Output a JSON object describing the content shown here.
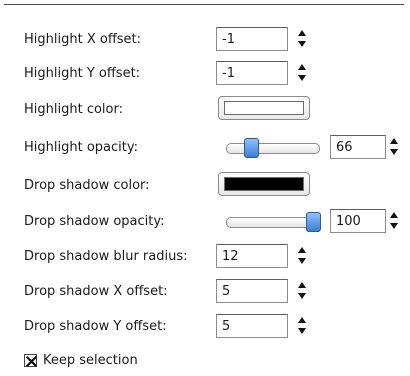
{
  "fields": {
    "highlight_x_offset": {
      "label": "Highlight X offset:",
      "value": "-1"
    },
    "highlight_y_offset": {
      "label": "Highlight Y offset:",
      "value": "-1"
    },
    "highlight_color": {
      "label": "Highlight color:",
      "color": "#ffffff"
    },
    "highlight_opacity": {
      "label": "Highlight opacity:",
      "value": "66",
      "level_percent": 22
    },
    "drop_shadow_color": {
      "label": "Drop shadow color:",
      "color": "#000000"
    },
    "drop_shadow_opacity": {
      "label": "Drop shadow opacity:",
      "value": "100",
      "level_percent": 100
    },
    "drop_shadow_blur_radius": {
      "label": "Drop shadow blur radius:",
      "value": "12"
    },
    "drop_shadow_x_offset": {
      "label": "Drop shadow X offset:",
      "value": "5"
    },
    "drop_shadow_y_offset": {
      "label": "Drop shadow Y offset:",
      "value": "5"
    }
  },
  "keep_selection": {
    "label": "Keep selection",
    "checked": true
  },
  "icons": {
    "spin": "spin-arrows-icon",
    "check": "check-mark-icon"
  },
  "colors": {
    "slider_thumb": "#3b7fd1",
    "border": "#8c8c8c"
  }
}
